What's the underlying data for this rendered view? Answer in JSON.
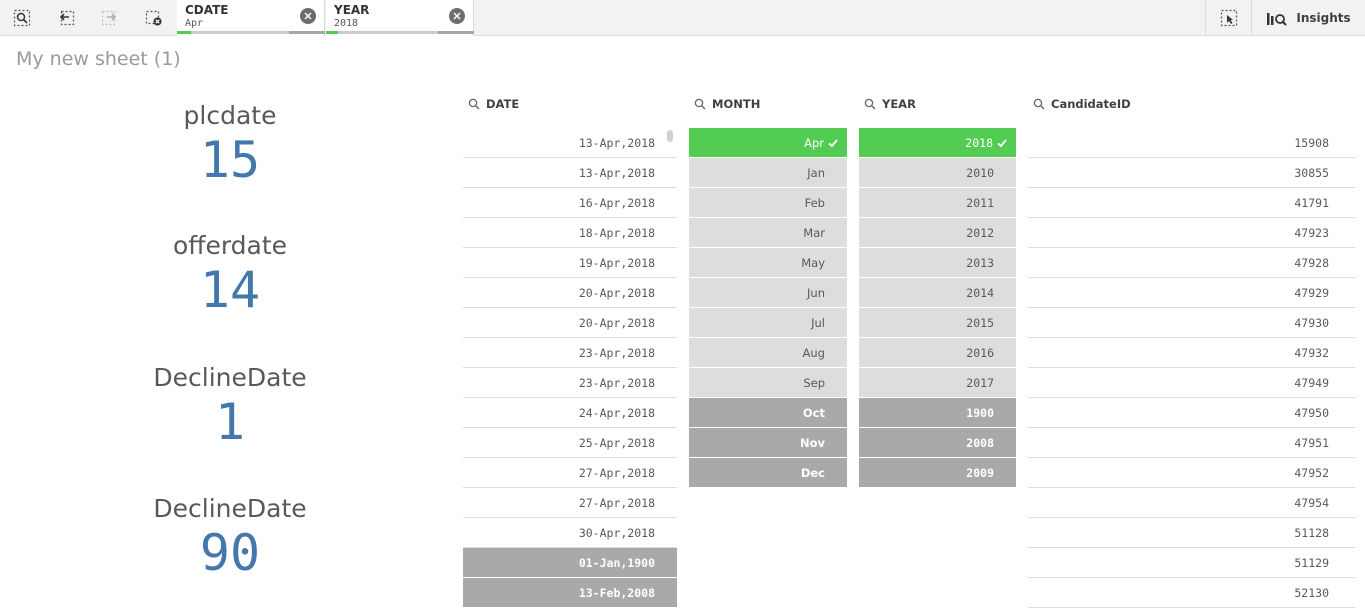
{
  "toolbar": {
    "icons": [
      "smart-search-icon",
      "step-back-icon",
      "step-forward-icon",
      "clear-selections-icon"
    ],
    "selections": [
      {
        "field": "CDATE",
        "value": "Apr"
      },
      {
        "field": "YEAR",
        "value": "2018"
      }
    ],
    "insights_label": "Insights"
  },
  "sheet": {
    "title": "My new sheet (1)"
  },
  "kpis": [
    {
      "label": "plcdate",
      "value": "15"
    },
    {
      "label": "offerdate",
      "value": "14"
    },
    {
      "label": "DeclineDate",
      "value": "1"
    },
    {
      "label": "DeclineDate",
      "value": "90"
    }
  ],
  "panes": {
    "date": {
      "title": "DATE",
      "items": [
        {
          "value": "13-Apr,2018",
          "state": "possible"
        },
        {
          "value": "13-Apr,2018",
          "state": "possible"
        },
        {
          "value": "16-Apr,2018",
          "state": "possible"
        },
        {
          "value": "18-Apr,2018",
          "state": "possible"
        },
        {
          "value": "19-Apr,2018",
          "state": "possible"
        },
        {
          "value": "20-Apr,2018",
          "state": "possible"
        },
        {
          "value": "20-Apr,2018",
          "state": "possible"
        },
        {
          "value": "23-Apr,2018",
          "state": "possible"
        },
        {
          "value": "23-Apr,2018",
          "state": "possible"
        },
        {
          "value": "24-Apr,2018",
          "state": "possible"
        },
        {
          "value": "25-Apr,2018",
          "state": "possible"
        },
        {
          "value": "27-Apr,2018",
          "state": "possible"
        },
        {
          "value": "27-Apr,2018",
          "state": "possible"
        },
        {
          "value": "30-Apr,2018",
          "state": "possible"
        },
        {
          "value": "01-Jan,1900",
          "state": "excluded"
        },
        {
          "value": "13-Feb,2008",
          "state": "excluded"
        }
      ]
    },
    "month": {
      "title": "MONTH",
      "items": [
        {
          "value": "Apr",
          "state": "selected"
        },
        {
          "value": "Jan",
          "state": "alternative"
        },
        {
          "value": "Feb",
          "state": "alternative"
        },
        {
          "value": "Mar",
          "state": "alternative"
        },
        {
          "value": "May",
          "state": "alternative"
        },
        {
          "value": "Jun",
          "state": "alternative"
        },
        {
          "value": "Jul",
          "state": "alternative"
        },
        {
          "value": "Aug",
          "state": "alternative"
        },
        {
          "value": "Sep",
          "state": "alternative"
        },
        {
          "value": "Oct",
          "state": "excluded"
        },
        {
          "value": "Nov",
          "state": "excluded"
        },
        {
          "value": "Dec",
          "state": "excluded"
        }
      ]
    },
    "year": {
      "title": "YEAR",
      "items": [
        {
          "value": "2018",
          "state": "selected"
        },
        {
          "value": "2010",
          "state": "alternative"
        },
        {
          "value": "2011",
          "state": "alternative"
        },
        {
          "value": "2012",
          "state": "alternative"
        },
        {
          "value": "2013",
          "state": "alternative"
        },
        {
          "value": "2014",
          "state": "alternative"
        },
        {
          "value": "2015",
          "state": "alternative"
        },
        {
          "value": "2016",
          "state": "alternative"
        },
        {
          "value": "2017",
          "state": "alternative"
        },
        {
          "value": "1900",
          "state": "excluded"
        },
        {
          "value": "2008",
          "state": "excluded"
        },
        {
          "value": "2009",
          "state": "excluded"
        }
      ]
    },
    "candidate": {
      "title": "CandidateID",
      "items": [
        {
          "value": "15908",
          "state": "possible"
        },
        {
          "value": "30855",
          "state": "possible"
        },
        {
          "value": "41791",
          "state": "possible"
        },
        {
          "value": "47923",
          "state": "possible"
        },
        {
          "value": "47928",
          "state": "possible"
        },
        {
          "value": "47929",
          "state": "possible"
        },
        {
          "value": "47930",
          "state": "possible"
        },
        {
          "value": "47932",
          "state": "possible"
        },
        {
          "value": "47949",
          "state": "possible"
        },
        {
          "value": "47950",
          "state": "possible"
        },
        {
          "value": "47951",
          "state": "possible"
        },
        {
          "value": "47952",
          "state": "possible"
        },
        {
          "value": "47954",
          "state": "possible"
        },
        {
          "value": "51128",
          "state": "possible"
        },
        {
          "value": "51129",
          "state": "possible"
        },
        {
          "value": "52130",
          "state": "possible"
        }
      ]
    }
  },
  "colors": {
    "selected": "#52cc52",
    "alternative": "#dddddd",
    "excluded": "#a9a9a9",
    "kpi_value": "#4477aa"
  }
}
